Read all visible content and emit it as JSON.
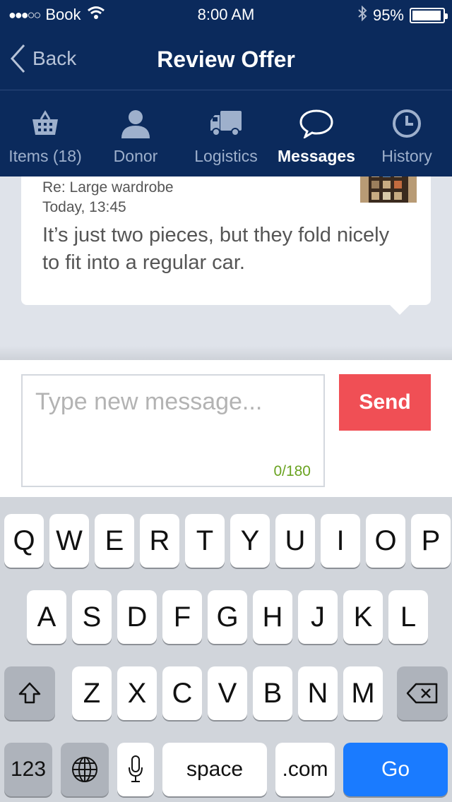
{
  "status_bar": {
    "signal": "●●●○○",
    "carrier": "Book",
    "time": "8:00 AM",
    "battery": "95%",
    "battery_level": 0.95
  },
  "nav": {
    "back_label": "Back",
    "title": "Review Offer"
  },
  "tabs": [
    {
      "label": "Items (18)",
      "icon": "basket-icon",
      "active": false
    },
    {
      "label": "Donor",
      "icon": "person-icon",
      "active": false
    },
    {
      "label": "Logistics",
      "icon": "truck-icon",
      "active": false
    },
    {
      "label": "Messages",
      "icon": "speech-bubble-icon",
      "active": true
    },
    {
      "label": "History",
      "icon": "clock-icon",
      "active": false
    }
  ],
  "message": {
    "subject": "Re: Large wardrobe",
    "time": "Today, 13:45",
    "body": "It’s just two pieces, but they fold nicely to fit into a regular car.",
    "thumbnail": "wardrobe-thumbnail"
  },
  "compose": {
    "placeholder": "Type new message...",
    "value": "",
    "counter": "0/180",
    "send_label": "Send"
  },
  "keyboard": {
    "row1": [
      "Q",
      "W",
      "E",
      "R",
      "T",
      "Y",
      "U",
      "I",
      "O",
      "P"
    ],
    "row2": [
      "A",
      "S",
      "D",
      "F",
      "G",
      "H",
      "J",
      "K",
      "L"
    ],
    "row3": [
      "Z",
      "X",
      "C",
      "V",
      "B",
      "N",
      "M"
    ],
    "numbers_label": "123",
    "space_label": "space",
    "dotcom_label": ".com",
    "go_label": "Go"
  },
  "colors": {
    "header": "#0b2a5c",
    "send": "#f04f55",
    "go": "#1a7bff",
    "counter": "#6aa321"
  }
}
